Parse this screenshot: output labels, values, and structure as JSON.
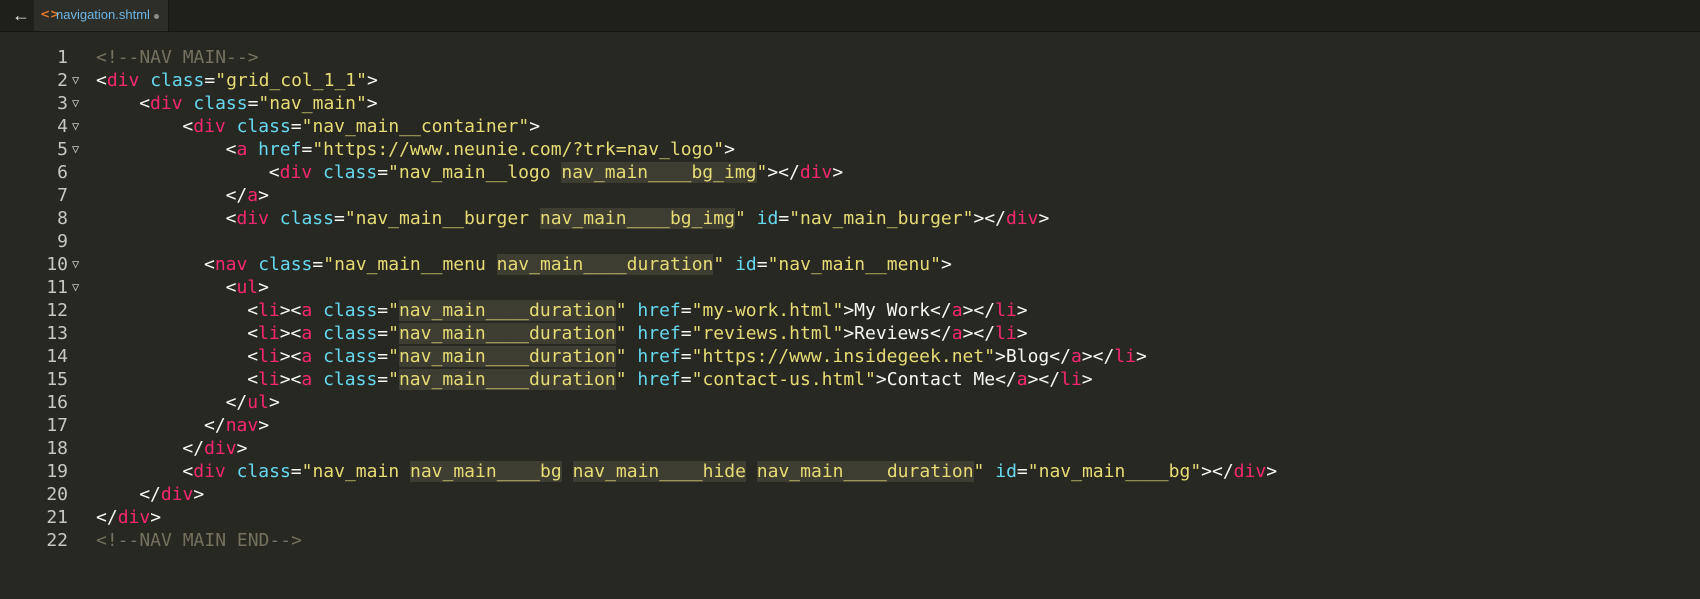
{
  "tab": {
    "back_icon": "arrow-left-icon",
    "file_icon": "code-file-icon",
    "file_icon_glyph": "<>",
    "file_name": "navigation.shtml",
    "unsaved_indicator": "dot",
    "file_icon_color": "#e87a2e",
    "file_name_color": "#6cb6e8"
  },
  "editor": {
    "background": "#272822",
    "colors": {
      "tag": "#f92672",
      "attr": "#66d9ef",
      "string": "#e6db74",
      "comment": "#75715e",
      "text": "#f8f8f2"
    },
    "lines": [
      {
        "num": "1",
        "fold": false,
        "indent": 0,
        "tokens": [
          [
            "c",
            "<!--NAV MAIN-->"
          ]
        ]
      },
      {
        "num": "2",
        "fold": true,
        "indent": 0,
        "tokens": [
          [
            "p",
            "<"
          ],
          [
            "t",
            "div"
          ],
          [
            "p",
            " "
          ],
          [
            "a",
            "class"
          ],
          [
            "p",
            "="
          ],
          [
            "s",
            "\"grid_col_1_1\""
          ],
          [
            "p",
            ">"
          ]
        ]
      },
      {
        "num": "3",
        "fold": true,
        "indent": 4,
        "tokens": [
          [
            "p",
            "<"
          ],
          [
            "t",
            "div"
          ],
          [
            "p",
            " "
          ],
          [
            "a",
            "class"
          ],
          [
            "p",
            "="
          ],
          [
            "s",
            "\"nav_main\""
          ],
          [
            "p",
            ">"
          ]
        ]
      },
      {
        "num": "4",
        "fold": true,
        "indent": 8,
        "tokens": [
          [
            "p",
            "<"
          ],
          [
            "t",
            "div"
          ],
          [
            "p",
            " "
          ],
          [
            "a",
            "class"
          ],
          [
            "p",
            "="
          ],
          [
            "s",
            "\"nav_main__container\""
          ],
          [
            "p",
            ">"
          ]
        ]
      },
      {
        "num": "5",
        "fold": true,
        "indent": 12,
        "tokens": [
          [
            "p",
            "<"
          ],
          [
            "t",
            "a"
          ],
          [
            "p",
            " "
          ],
          [
            "a",
            "href"
          ],
          [
            "p",
            "="
          ],
          [
            "s",
            "\"https://www.neunie.com/?trk=nav_logo\""
          ],
          [
            "p",
            ">"
          ]
        ]
      },
      {
        "num": "6",
        "fold": false,
        "indent": 16,
        "tokens": [
          [
            "p",
            "<"
          ],
          [
            "t",
            "div"
          ],
          [
            "p",
            " "
          ],
          [
            "a",
            "class"
          ],
          [
            "p",
            "="
          ],
          [
            "s",
            "\"nav_main__logo "
          ],
          [
            "h",
            "nav_main____bg_img"
          ],
          [
            "s",
            "\""
          ],
          [
            "p",
            "></"
          ],
          [
            "t",
            "div"
          ],
          [
            "p",
            ">"
          ]
        ]
      },
      {
        "num": "7",
        "fold": false,
        "indent": 12,
        "tokens": [
          [
            "p",
            "</"
          ],
          [
            "t",
            "a"
          ],
          [
            "p",
            ">"
          ]
        ]
      },
      {
        "num": "8",
        "fold": false,
        "indent": 12,
        "tokens": [
          [
            "p",
            "<"
          ],
          [
            "t",
            "div"
          ],
          [
            "p",
            " "
          ],
          [
            "a",
            "class"
          ],
          [
            "p",
            "="
          ],
          [
            "s",
            "\"nav_main__burger "
          ],
          [
            "h",
            "nav_main____bg_img"
          ],
          [
            "s",
            "\""
          ],
          [
            "p",
            " "
          ],
          [
            "a",
            "id"
          ],
          [
            "p",
            "="
          ],
          [
            "s",
            "\"nav_main_burger\""
          ],
          [
            "p",
            "></"
          ],
          [
            "t",
            "div"
          ],
          [
            "p",
            ">"
          ]
        ]
      },
      {
        "num": "9",
        "fold": false,
        "indent": 0,
        "tokens": []
      },
      {
        "num": "10",
        "fold": true,
        "indent": 10,
        "tokens": [
          [
            "p",
            "<"
          ],
          [
            "t",
            "nav"
          ],
          [
            "p",
            " "
          ],
          [
            "a",
            "class"
          ],
          [
            "p",
            "="
          ],
          [
            "s",
            "\"nav_main__menu "
          ],
          [
            "h",
            "nav_main____duration"
          ],
          [
            "s",
            "\""
          ],
          [
            "p",
            " "
          ],
          [
            "a",
            "id"
          ],
          [
            "p",
            "="
          ],
          [
            "s",
            "\"nav_main__menu\""
          ],
          [
            "p",
            ">"
          ]
        ]
      },
      {
        "num": "11",
        "fold": true,
        "indent": 12,
        "tokens": [
          [
            "p",
            "<"
          ],
          [
            "t",
            "ul"
          ],
          [
            "p",
            ">"
          ]
        ]
      },
      {
        "num": "12",
        "fold": false,
        "indent": 14,
        "tokens": [
          [
            "p",
            "<"
          ],
          [
            "t",
            "li"
          ],
          [
            "p",
            "><"
          ],
          [
            "t",
            "a"
          ],
          [
            "p",
            " "
          ],
          [
            "a",
            "class"
          ],
          [
            "p",
            "="
          ],
          [
            "s",
            "\""
          ],
          [
            "h",
            "nav_main____duration"
          ],
          [
            "s",
            "\""
          ],
          [
            "p",
            " "
          ],
          [
            "a",
            "href"
          ],
          [
            "p",
            "="
          ],
          [
            "s",
            "\"my-work.html\""
          ],
          [
            "p",
            ">"
          ],
          [
            "x",
            "My Work"
          ],
          [
            "p",
            "</"
          ],
          [
            "t",
            "a"
          ],
          [
            "p",
            "></"
          ],
          [
            "t",
            "li"
          ],
          [
            "p",
            ">"
          ]
        ]
      },
      {
        "num": "13",
        "fold": false,
        "indent": 14,
        "tokens": [
          [
            "p",
            "<"
          ],
          [
            "t",
            "li"
          ],
          [
            "p",
            "><"
          ],
          [
            "t",
            "a"
          ],
          [
            "p",
            " "
          ],
          [
            "a",
            "class"
          ],
          [
            "p",
            "="
          ],
          [
            "s",
            "\""
          ],
          [
            "h",
            "nav_main____duration"
          ],
          [
            "s",
            "\""
          ],
          [
            "p",
            " "
          ],
          [
            "a",
            "href"
          ],
          [
            "p",
            "="
          ],
          [
            "s",
            "\"reviews.html\""
          ],
          [
            "p",
            ">"
          ],
          [
            "x",
            "Reviews"
          ],
          [
            "p",
            "</"
          ],
          [
            "t",
            "a"
          ],
          [
            "p",
            "></"
          ],
          [
            "t",
            "li"
          ],
          [
            "p",
            ">"
          ]
        ]
      },
      {
        "num": "14",
        "fold": false,
        "indent": 14,
        "tokens": [
          [
            "p",
            "<"
          ],
          [
            "t",
            "li"
          ],
          [
            "p",
            "><"
          ],
          [
            "t",
            "a"
          ],
          [
            "p",
            " "
          ],
          [
            "a",
            "class"
          ],
          [
            "p",
            "="
          ],
          [
            "s",
            "\""
          ],
          [
            "h",
            "nav_main____duration"
          ],
          [
            "s",
            "\""
          ],
          [
            "p",
            " "
          ],
          [
            "a",
            "href"
          ],
          [
            "p",
            "="
          ],
          [
            "s",
            "\"https://www.insidegeek.net\""
          ],
          [
            "p",
            ">"
          ],
          [
            "x",
            "Blog"
          ],
          [
            "p",
            "</"
          ],
          [
            "t",
            "a"
          ],
          [
            "p",
            "></"
          ],
          [
            "t",
            "li"
          ],
          [
            "p",
            ">"
          ]
        ]
      },
      {
        "num": "15",
        "fold": false,
        "indent": 14,
        "tokens": [
          [
            "p",
            "<"
          ],
          [
            "t",
            "li"
          ],
          [
            "p",
            "><"
          ],
          [
            "t",
            "a"
          ],
          [
            "p",
            " "
          ],
          [
            "a",
            "class"
          ],
          [
            "p",
            "="
          ],
          [
            "s",
            "\""
          ],
          [
            "h",
            "nav_main____duration"
          ],
          [
            "s",
            "\""
          ],
          [
            "p",
            " "
          ],
          [
            "a",
            "href"
          ],
          [
            "p",
            "="
          ],
          [
            "s",
            "\"contact-us.html\""
          ],
          [
            "p",
            ">"
          ],
          [
            "x",
            "Contact Me"
          ],
          [
            "p",
            "</"
          ],
          [
            "t",
            "a"
          ],
          [
            "p",
            "></"
          ],
          [
            "t",
            "li"
          ],
          [
            "p",
            ">"
          ]
        ]
      },
      {
        "num": "16",
        "fold": false,
        "indent": 12,
        "tokens": [
          [
            "p",
            "</"
          ],
          [
            "t",
            "ul"
          ],
          [
            "p",
            ">"
          ]
        ]
      },
      {
        "num": "17",
        "fold": false,
        "indent": 10,
        "tokens": [
          [
            "p",
            "</"
          ],
          [
            "t",
            "nav"
          ],
          [
            "p",
            ">"
          ]
        ]
      },
      {
        "num": "18",
        "fold": false,
        "indent": 8,
        "tokens": [
          [
            "p",
            "</"
          ],
          [
            "t",
            "div"
          ],
          [
            "p",
            ">"
          ]
        ]
      },
      {
        "num": "19",
        "fold": false,
        "indent": 8,
        "tokens": [
          [
            "p",
            "<"
          ],
          [
            "t",
            "div"
          ],
          [
            "p",
            " "
          ],
          [
            "a",
            "class"
          ],
          [
            "p",
            "="
          ],
          [
            "s",
            "\"nav_main "
          ],
          [
            "h",
            "nav_main____bg"
          ],
          [
            "s",
            " "
          ],
          [
            "h",
            "nav_main____hide"
          ],
          [
            "s",
            " "
          ],
          [
            "h",
            "nav_main____duration"
          ],
          [
            "s",
            "\""
          ],
          [
            "p",
            " "
          ],
          [
            "a",
            "id"
          ],
          [
            "p",
            "="
          ],
          [
            "s",
            "\"nav_main____bg\""
          ],
          [
            "p",
            "></"
          ],
          [
            "t",
            "div"
          ],
          [
            "p",
            ">"
          ]
        ]
      },
      {
        "num": "20",
        "fold": false,
        "indent": 4,
        "tokens": [
          [
            "p",
            "</"
          ],
          [
            "t",
            "div"
          ],
          [
            "p",
            ">"
          ]
        ]
      },
      {
        "num": "21",
        "fold": false,
        "indent": 0,
        "tokens": [
          [
            "p",
            "</"
          ],
          [
            "t",
            "div"
          ],
          [
            "p",
            ">"
          ]
        ]
      },
      {
        "num": "22",
        "fold": false,
        "indent": 0,
        "tokens": [
          [
            "c",
            "<!--NAV MAIN END-->"
          ]
        ]
      }
    ]
  }
}
